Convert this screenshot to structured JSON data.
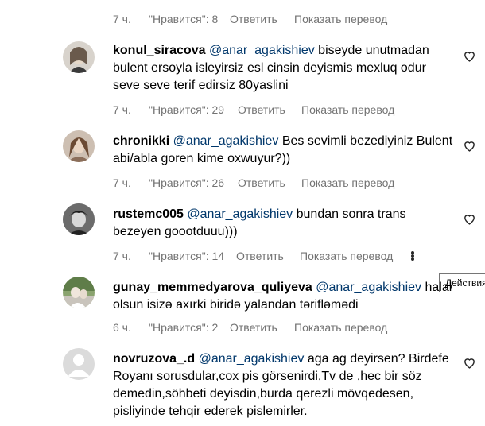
{
  "top_meta": {
    "time": "7 ч.",
    "likes": "\"Нравится\": 8",
    "reply": "Ответить",
    "translate": "Показать перевод"
  },
  "comments": [
    {
      "username": "konul_siracova",
      "mention": "@anar_agakishiev",
      "text": "biseyde unutmadan bulent ersoyla isleyirsiz esl cinsin deyismis mexluq odur seve seve terif edirsiz 80yaslini",
      "time": "7 ч.",
      "likes": "\"Нравится\": 29",
      "reply": "Ответить",
      "translate": "Показать перевод"
    },
    {
      "username": "chronikki",
      "mention": "@anar_agakishiev",
      "text": "Bes sevimli bezediyiniz Bulent abi/abla goren kime oxwuyur?))",
      "time": "7 ч.",
      "likes": "\"Нравится\": 26",
      "reply": "Ответить",
      "translate": "Показать перевод"
    },
    {
      "username": "rustemc005",
      "mention": "@anar_agakishiev",
      "text": "bundan sonra trans bezeyen goootduuu)))",
      "time": "7 ч.",
      "likes": "\"Нравится\": 14",
      "reply": "Ответить",
      "translate": "Показать перевод"
    },
    {
      "username": "gunay_memmedyarova_quliyeva",
      "mention": "@anar_agakishiev",
      "text": "halal olsun isizə axırki biridə yalandan tərifləmədi",
      "time": "6 ч.",
      "likes": "\"Нравится\": 2",
      "reply": "Ответить",
      "translate": "Показать перевод"
    },
    {
      "username": "novruzova_.d",
      "mention": "@anar_agakishiev",
      "text": "aga ag deyirsen? Birdefe Royanı sorusdular,cox pis görsenirdi,Tv de ,hec bir söz demedin,söhbeti deyisdin,burda qerezli mövqedesen, pisliyinde tehqir ederek pislemirler."
    }
  ],
  "tooltip": "Действия",
  "colors": {
    "meta_gray": "#737373",
    "mention_blue": "#00376b"
  }
}
